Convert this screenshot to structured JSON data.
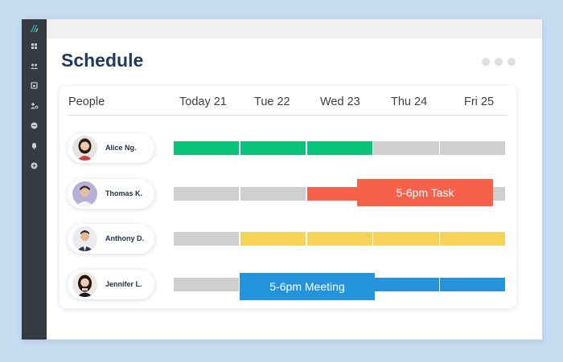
{
  "app": {
    "title": "Schedule",
    "accent": "#1f3b5c"
  },
  "sidebar": {
    "items": [
      {
        "icon": "app-logo-icon"
      },
      {
        "icon": "dashboard-grid-icon"
      },
      {
        "icon": "team-icon"
      },
      {
        "icon": "calendar-icon"
      },
      {
        "icon": "user-settings-icon"
      },
      {
        "icon": "chat-icon"
      },
      {
        "icon": "bell-icon"
      },
      {
        "icon": "add-circle-icon"
      }
    ]
  },
  "header": {
    "people": "People",
    "days": [
      "Today 21",
      "Tue 22",
      "Wed 23",
      "Thu 24",
      "Fri 25"
    ]
  },
  "colors": {
    "green": "#08c47a",
    "red": "#f5614a",
    "yellow": "#f6d258",
    "blue": "#2394db",
    "gray": "#cfcfd0"
  },
  "rows": [
    {
      "name": "Alice Ng.",
      "avatar_icon": "alice-avatar",
      "days": [
        "green",
        "green",
        "green",
        "gray",
        "gray"
      ]
    },
    {
      "name": "Thomas K.",
      "avatar_icon": "thomas-avatar",
      "days": [
        "gray",
        "gray",
        "red",
        "red",
        "gray"
      ]
    },
    {
      "name": "Anthony D.",
      "avatar_icon": "anthony-avatar",
      "days": [
        "gray",
        "yellow",
        "yellow",
        "yellow",
        "yellow"
      ]
    },
    {
      "name": "Jennifer L.",
      "avatar_icon": "jennifer-avatar",
      "days": [
        "gray",
        "gray",
        "blue",
        "blue",
        "blue"
      ]
    }
  ],
  "events": {
    "task": {
      "label": "5-6pm Task",
      "color": "#f5614a"
    },
    "meeting": {
      "label": "5-6pm Meeting",
      "color": "#2394db"
    }
  }
}
